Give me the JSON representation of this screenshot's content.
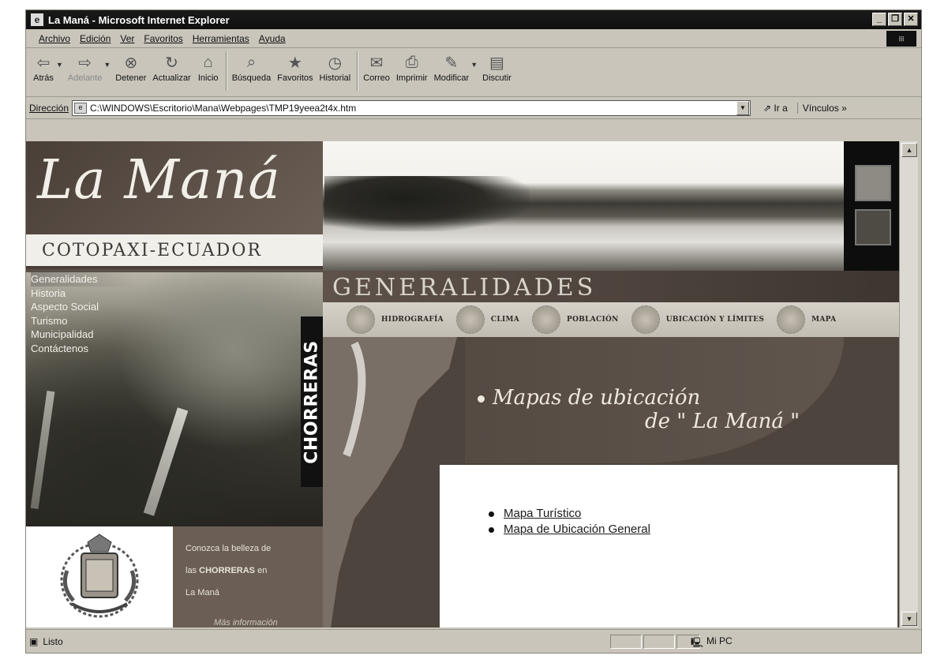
{
  "window": {
    "title": "La Maná - Microsoft Internet Explorer",
    "controls": [
      "_",
      "❐",
      "✕"
    ]
  },
  "menu": {
    "items": [
      "Archivo",
      "Edición",
      "Ver",
      "Favoritos",
      "Herramientas",
      "Ayuda"
    ]
  },
  "toolbar": {
    "back": "Atrás",
    "forward": "Adelante",
    "stop": "Detener",
    "refresh": "Actualizar",
    "home": "Inicio",
    "search": "Búsqueda",
    "favorites": "Favoritos",
    "history": "Historial",
    "mail": "Correo",
    "print": "Imprimir",
    "edit": "Modificar",
    "discuss": "Discutir"
  },
  "address": {
    "label": "Dirección",
    "value": "C:\\WINDOWS\\Escritorio\\Mana\\Webpages\\TMP19yeea2t4x.htm",
    "go": "Ir a",
    "links": "Vínculos »"
  },
  "page": {
    "logo_title": "La Maná",
    "subtitle": "COTOPAXI-ECUADOR",
    "nav": [
      "Generalidades",
      "Historia",
      "Aspecto Social",
      "Turismo",
      "Municipalidad",
      "Contáctenos"
    ],
    "side_tab": "CHORRERAS",
    "section_title": "GENERALIDADES",
    "subnav": [
      "HIDROGRAFÍA",
      "CLIMA",
      "POBLACIÓN",
      "UBICACIÓN Y LÍMITES",
      "MAPA"
    ],
    "heading_line1": "Mapas de ubicación",
    "heading_line2": "de \" La Maná \"",
    "links": [
      "Mapa Turístico",
      "Mapa de Ubicación General"
    ],
    "promo": {
      "line1": "Conozca la belleza de",
      "line2_pre": "las ",
      "line2_bold": "CHORRERAS",
      "line2_post": " en",
      "line3": "La Maná",
      "more": "Más información"
    }
  },
  "status": {
    "text": "Listo",
    "zone": "Mi PC"
  }
}
